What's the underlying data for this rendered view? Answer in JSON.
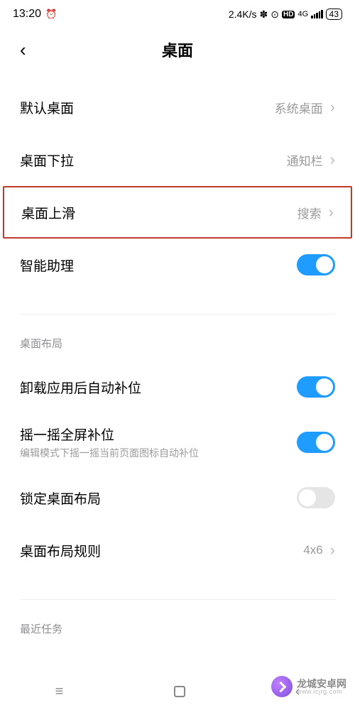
{
  "status": {
    "time": "13:20",
    "alarm_icon": "⏰",
    "net_speed": "2.4K/s",
    "bt_icon": "✽",
    "clock_icon": "⊙",
    "hd_icon": "HD",
    "net_type": "4G",
    "battery": "43"
  },
  "header": {
    "back_icon": "‹",
    "title": "桌面"
  },
  "rows": {
    "default_launcher": {
      "label": "默认桌面",
      "value": "系统桌面"
    },
    "pull_down": {
      "label": "桌面下拉",
      "value": "通知栏"
    },
    "swipe_up": {
      "label": "桌面上滑",
      "value": "搜索"
    },
    "assistant": {
      "label": "智能助理",
      "on": true
    }
  },
  "section_layout": {
    "header": "桌面布局",
    "auto_fill": {
      "label": "卸载应用后自动补位",
      "on": true
    },
    "shake_fill": {
      "label": "摇一摇全屏补位",
      "sub": "编辑模式下摇一摇当前页面图标自动补位",
      "on": true
    },
    "lock_layout": {
      "label": "锁定桌面布局",
      "on": false
    },
    "grid": {
      "label": "桌面布局规则",
      "value": "4x6"
    }
  },
  "section_recent": {
    "header": "最近任务"
  },
  "chevron": "›",
  "nav": {
    "menu": "≡",
    "back": "‹"
  },
  "watermark": {
    "main": "龙城安卓网",
    "sub": "www.lcjrg.com"
  }
}
